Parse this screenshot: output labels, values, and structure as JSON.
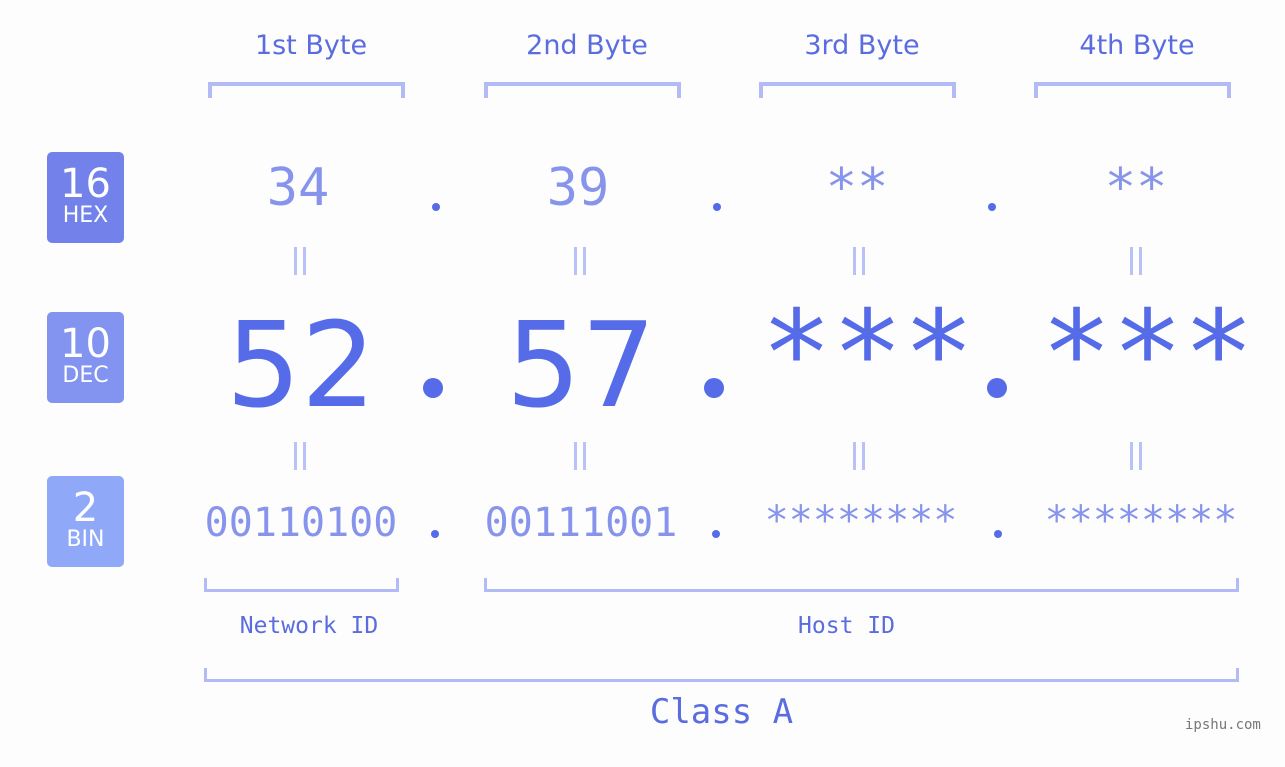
{
  "bytes": [
    {
      "label": "1st Byte",
      "hex": "34",
      "dec": "52",
      "bin": "00110100"
    },
    {
      "label": "2nd Byte",
      "hex": "39",
      "dec": "57",
      "bin": "00111001"
    },
    {
      "label": "3rd Byte",
      "hex": "**",
      "dec": "***",
      "bin": "********"
    },
    {
      "label": "4th Byte",
      "hex": "**",
      "dec": "***",
      "bin": "********"
    }
  ],
  "bases": {
    "hex": {
      "num": "16",
      "label": "HEX"
    },
    "dec": {
      "num": "10",
      "label": "DEC"
    },
    "bin": {
      "num": "2",
      "label": "BIN"
    }
  },
  "network_id_label": "Network ID",
  "host_id_label": "Host ID",
  "class_label": "Class A",
  "watermark": "ipshu.com",
  "colors": {
    "primary": "#556be8",
    "light": "#8794ec",
    "bracket": "#b3bbf6"
  }
}
